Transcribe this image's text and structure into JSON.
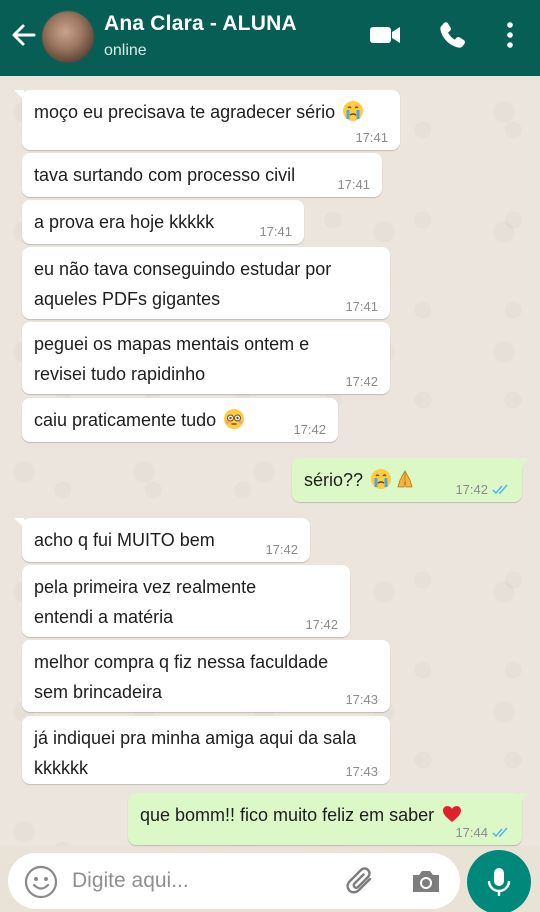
{
  "header": {
    "name": "Ana Clara - ALUNA",
    "status": "online",
    "color": "#075e54"
  },
  "messages": [
    {
      "dir": "in",
      "text": "moço eu precisava te agradecer sério",
      "emoji": [
        "crying-face"
      ],
      "time": "17:41"
    },
    {
      "dir": "in",
      "text": "tava surtando com processo civil",
      "time": "17:41"
    },
    {
      "dir": "in",
      "text": "a prova era hoje kkkkk",
      "time": "17:41"
    },
    {
      "dir": "in",
      "text": "eu não tava conseguindo estudar por\naqueles PDFs gigantes",
      "time": "17:41"
    },
    {
      "dir": "in",
      "text": "peguei os mapas mentais ontem e\nrevisei tudo rapidinho",
      "time": "17:42"
    },
    {
      "dir": "in",
      "text": "caiu praticamente tudo",
      "emoji": [
        "flushed-face"
      ],
      "time": "17:42"
    },
    {
      "dir": "out",
      "text": "sério??",
      "emoji": [
        "crying-face",
        "praying-hands"
      ],
      "time": "17:42",
      "read": true
    },
    {
      "dir": "in",
      "text": "acho q fui MUITO bem",
      "time": "17:42"
    },
    {
      "dir": "in",
      "text": "pela primeira vez realmente\nentendi a matéria",
      "time": "17:42"
    },
    {
      "dir": "in",
      "text": "melhor compra q fiz nessa faculdade\nsem brincadeira",
      "time": "17:43"
    },
    {
      "dir": "in",
      "text": "já indiquei pra minha amiga aqui da sala\nkkkkkk",
      "time": "17:43"
    },
    {
      "dir": "out",
      "text": "que bomm!! fico muito feliz em saber",
      "emoji": [
        "red-heart"
      ],
      "time": "17:44",
      "read": true
    }
  ],
  "input": {
    "placeholder": "Digite aqui..."
  },
  "colors": {
    "incoming": "#ffffff",
    "outgoing": "#dcf8c6",
    "read_ticks": "#4fb6ec",
    "mic": "#00897b"
  }
}
